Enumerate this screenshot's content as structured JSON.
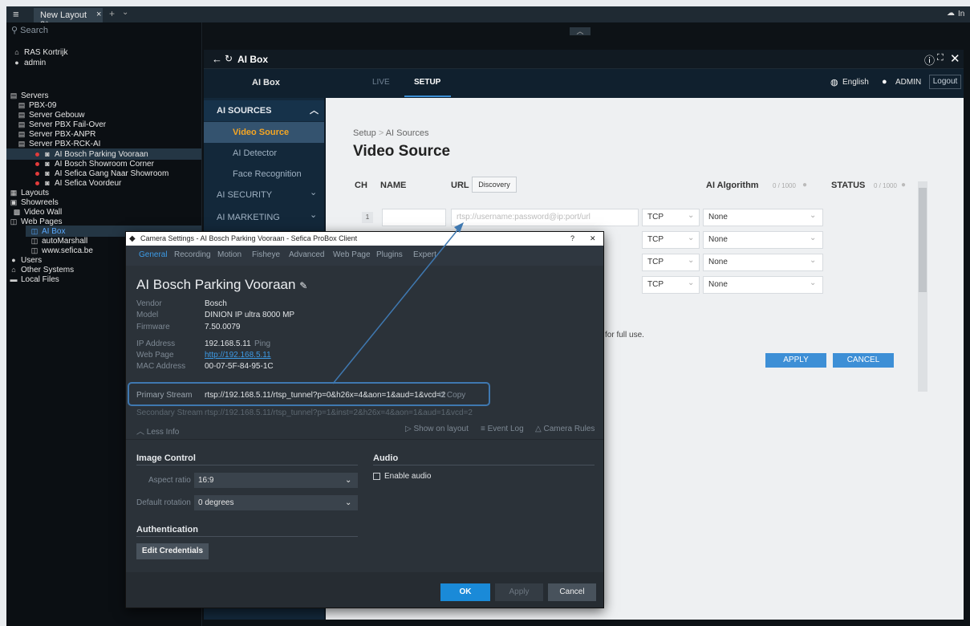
{
  "topbar": {
    "tab_label": "New Layout 2*",
    "right_label": "In"
  },
  "sidebar": {
    "search_placeholder": "Search",
    "site": "RAS Kortrijk",
    "user": "admin",
    "items": [
      {
        "label": "Servers"
      },
      {
        "label": "PBX-09"
      },
      {
        "label": "Server Gebouw"
      },
      {
        "label": "Server PBX Fail-Over"
      },
      {
        "label": "Server PBX-ANPR"
      },
      {
        "label": "Server PBX-RCK-AI"
      },
      {
        "label": "AI Bosch Parking Vooraan"
      },
      {
        "label": "AI Bosch Showroom Corner"
      },
      {
        "label": "AI Sefica Gang Naar Showroom"
      },
      {
        "label": "AI Sefica Voordeur"
      },
      {
        "label": "Layouts"
      },
      {
        "label": "Showreels"
      },
      {
        "label": "Video Wall"
      },
      {
        "label": "Web Pages"
      },
      {
        "label": "AI Box"
      },
      {
        "label": "autoMarshall"
      },
      {
        "label": "www.sefica.be"
      },
      {
        "label": "Users"
      },
      {
        "label": "Other Systems"
      },
      {
        "label": "Local Files"
      }
    ]
  },
  "aibox": {
    "window_title": "AI Box",
    "brand": "AI Box",
    "tabs": {
      "live": "LIVE",
      "setup": "SETUP"
    },
    "language": "English",
    "user": "ADMIN",
    "logout": "Logout",
    "nav": {
      "sources": "AI SOURCES",
      "video_source": "Video Source",
      "detector": "AI Detector",
      "face": "Face Recognition",
      "security": "AI SECURITY",
      "marketing": "AI MARKETING"
    },
    "breadcrumb": {
      "root": "Setup",
      "sep": ">",
      "current": "AI Sources"
    },
    "page_title": "Video Source",
    "table": {
      "ch": "CH",
      "name": "NAME",
      "url": "URL",
      "discovery": "Discovery",
      "algo": "AI Algorithm",
      "algo_count": "0 / 1000",
      "status": "STATUS",
      "status_count": "0 / 1000"
    },
    "row1": {
      "ch": "1",
      "url_placeholder": "rtsp://username:password@ip:port/url"
    },
    "protocol": "TCP",
    "algorithm": "None",
    "note": "uired for full use.",
    "apply": "APPLY",
    "cancel": "CANCEL"
  },
  "dialog": {
    "title": "Camera Settings - AI Bosch Parking Vooraan - Sefica ProBox Client",
    "help": "?",
    "close": "✕",
    "tabs": [
      "General",
      "Recording",
      "Motion",
      "Fisheye",
      "Advanced",
      "Web Page",
      "Plugins",
      "Expert"
    ],
    "camera_name": "AI Bosch Parking Vooraan",
    "vendor_label": "Vendor",
    "vendor": "Bosch",
    "model_label": "Model",
    "model": "DINION IP ultra 8000 MP",
    "firmware_label": "Firmware",
    "firmware": "7.50.0079",
    "ip_label": "IP Address",
    "ip": "192.168.5.11",
    "ping": "Ping",
    "web_label": "Web Page",
    "web": "http://192.168.5.11",
    "mac_label": "MAC Address",
    "mac": "00-07-5F-84-95-1C",
    "primary_label": "Primary Stream",
    "primary": "rtsp://192.168.5.11/rtsp_tunnel?p=0&h26x=4&aon=1&aud=1&vcd=2",
    "secondary_label": "Secondary Stream",
    "secondary": "rtsp://192.168.5.11/rtsp_tunnel?p=1&inst=2&h26x=4&aon=1&aud=1&vcd=2",
    "copy": "Copy",
    "less_info": "Less Info",
    "show_on_layout": "Show on layout",
    "event_log": "Event Log",
    "camera_rules": "Camera Rules",
    "image_control": "Image Control",
    "aspect_label": "Aspect ratio",
    "aspect": "16:9",
    "rotation_label": "Default rotation",
    "rotation": "0 degrees",
    "audio": "Audio",
    "enable_audio": "Enable audio",
    "auth": "Authentication",
    "edit_credentials": "Edit Credentials",
    "ok": "OK",
    "apply": "Apply",
    "cancel": "Cancel"
  },
  "colors": {
    "accent": "#3d8fd6",
    "highlight": "#3f78b0",
    "ok": "#1a8ad8"
  }
}
